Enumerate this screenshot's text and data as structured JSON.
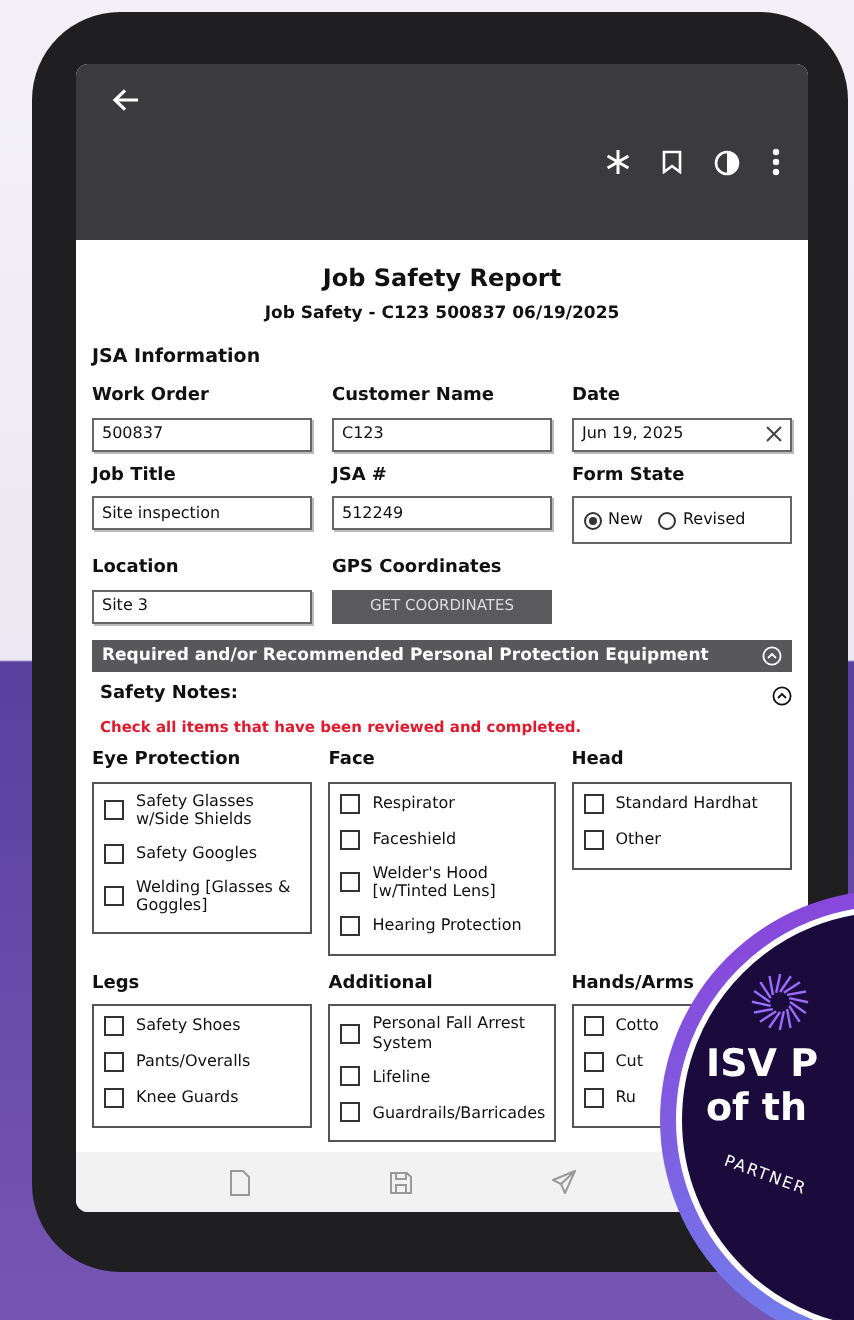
{
  "report": {
    "title": "Job Safety Report",
    "subtitle": "Job Safety - C123 500837 06/19/2025"
  },
  "section_title": "JSA Information",
  "fields": [
    {
      "kind": "text",
      "label": "Work Order",
      "value": "500837"
    },
    {
      "kind": "text",
      "label": "Customer Name",
      "value": "C123"
    },
    {
      "kind": "date",
      "label": "Date",
      "value": "Jun 19, 2025"
    },
    {
      "kind": "text",
      "label": "Job Title",
      "value": "Site inspection"
    },
    {
      "kind": "text",
      "label": "JSA #",
      "value": "512249"
    },
    {
      "kind": "radio",
      "label": "Form State",
      "options": [
        {
          "label": "New",
          "selected": true
        },
        {
          "label": "Revised",
          "selected": false
        }
      ]
    },
    {
      "kind": "text",
      "label": "Location",
      "value": "Site 3"
    },
    {
      "kind": "button",
      "label": "GPS Coordinates",
      "button": "GET COORDINATES"
    }
  ],
  "ppe_section": {
    "title": "Required and/or Recommended Personal Protection Equipment",
    "expanded": true
  },
  "safety_notes": {
    "title": "Safety Notes:",
    "expanded": true,
    "instruction": "Check all items that have been reviewed and completed."
  },
  "groups": [
    {
      "title": "Eye Protection",
      "items": [
        {
          "label": "Safety Glasses w/Side Shields",
          "checked": false
        },
        {
          "label": "Safety Googles",
          "checked": false
        },
        {
          "label": "Welding [Glasses & Goggles]",
          "checked": false
        }
      ]
    },
    {
      "title": "Face",
      "items": [
        {
          "label": "Respirator",
          "checked": false
        },
        {
          "label": "Faceshield",
          "checked": false
        },
        {
          "label": "Welder's Hood [w/Tinted Lens]",
          "checked": false
        },
        {
          "label": "Hearing Protection",
          "checked": false
        }
      ]
    },
    {
      "title": "Head",
      "items": [
        {
          "label": "Standard Hardhat",
          "checked": false
        },
        {
          "label": "Other",
          "checked": false
        }
      ]
    },
    {
      "title": "Legs",
      "items": [
        {
          "label": "Safety Shoes",
          "checked": false
        },
        {
          "label": "Pants/Overalls",
          "checked": false
        },
        {
          "label": "Knee Guards",
          "checked": false
        }
      ]
    },
    {
      "title": "Additional",
      "items": [
        {
          "label": "Personal Fall Arrest System",
          "checked": false
        },
        {
          "label": "Lifeline",
          "checked": false
        },
        {
          "label": "Guardrails/Barricades",
          "checked": false
        }
      ]
    },
    {
      "title": "Hands/Arms",
      "items": [
        {
          "label": "Cotto",
          "checked": false
        },
        {
          "label": "Cut",
          "checked": false
        },
        {
          "label": "Ru",
          "checked": false
        }
      ]
    }
  ],
  "badge": {
    "lines": [
      "ISV P",
      "of th"
    ],
    "footer": "PARTNER"
  }
}
